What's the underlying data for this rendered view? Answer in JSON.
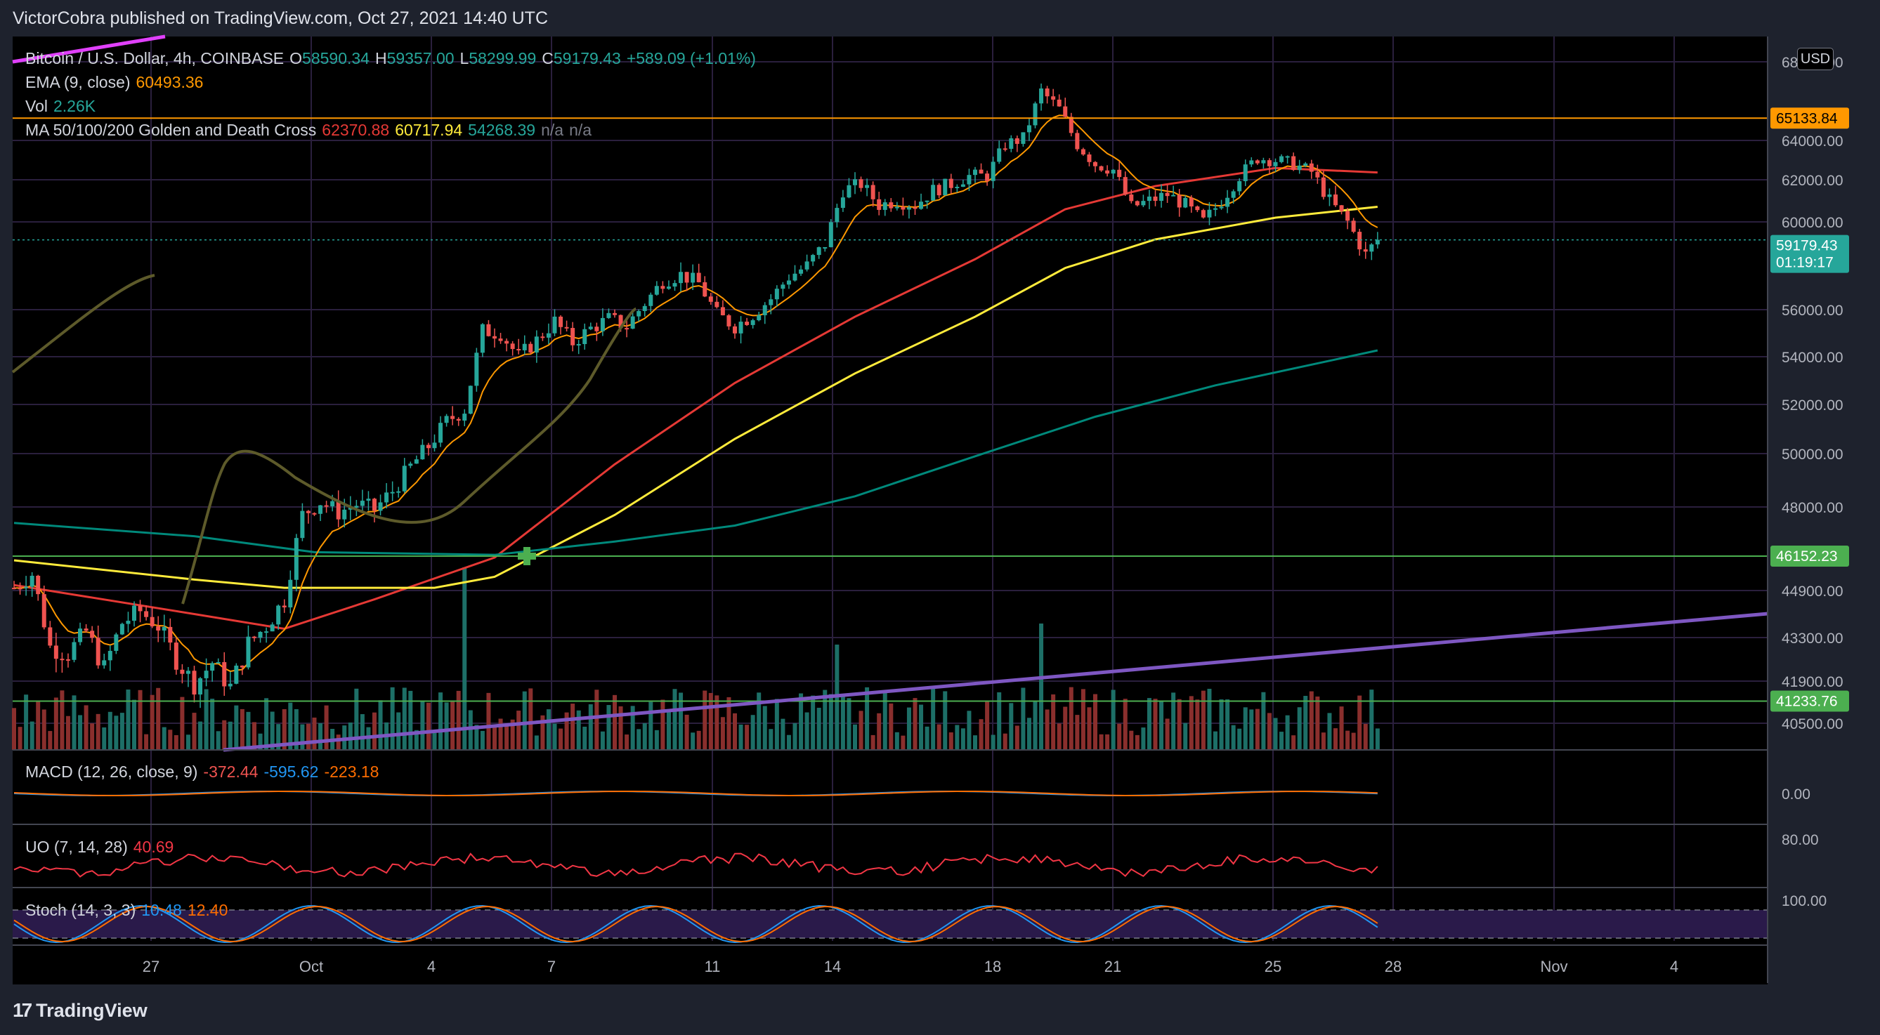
{
  "header": {
    "published": "VictorCobra published on TradingView.com, Oct 27, 2021 14:40 UTC"
  },
  "legend": {
    "symbol": "Bitcoin / U.S. Dollar, 4h, COINBASE",
    "open_label": "O",
    "open": "58590.34",
    "high_label": "H",
    "high": "59357.00",
    "low_label": "L",
    "low": "58299.99",
    "close_label": "C",
    "close": "59179.43",
    "change": "+589.09 (+1.01%)",
    "ema_label": "EMA (9, close)",
    "ema_value": "60493.36",
    "vol_label": "Vol",
    "vol_value": "2.26K",
    "ma_label": "MA 50/100/200 Golden and Death Cross",
    "ma50": "62370.88",
    "ma100": "60717.94",
    "ma200": "54268.39",
    "na1": "n/a",
    "na2": "n/a",
    "macd_label": "MACD (12, 26, close, 9)",
    "macd1": "-372.44",
    "macd2": "-595.62",
    "macd3": "-223.18",
    "uo_label": "UO (7, 14, 28)",
    "uo_value": "40.69",
    "stoch_label": "Stoch (14, 3, 3)",
    "stoch_k": "10.48",
    "stoch_d": "12.40"
  },
  "currency_badge": "USD",
  "footer": {
    "brand": "TradingView"
  },
  "colors": {
    "bull": "#26a69a",
    "bear": "#ef5350",
    "ema": "#ff9800",
    "ma50": "#e53935",
    "ma100": "#ffeb3b",
    "ma200": "#00897b",
    "resistance": "#ff9800",
    "support": "#4caf50",
    "trend": "#7e57c2",
    "pink": "#e040fb",
    "olive": "#5d5a2a"
  },
  "chart_data": {
    "type": "candlestick",
    "title": "Bitcoin / U.S. Dollar, 4h, COINBASE",
    "y_axis_labels": [
      "68000.00",
      "64000.00",
      "62000.00",
      "60000.00",
      "56000.00",
      "54000.00",
      "52000.00",
      "50000.00",
      "48000.00",
      "44900.00",
      "43300.00",
      "41900.00",
      "40500.00"
    ],
    "x_axis_labels": [
      "27",
      "Oct",
      "4",
      "7",
      "11",
      "14",
      "18",
      "21",
      "25",
      "28",
      "Nov",
      "4"
    ],
    "price_badges": [
      {
        "value": "65133.84",
        "color": "#ff9800"
      },
      {
        "value": "59179.43",
        "sub": "01:19:17",
        "color": "#26a69a"
      },
      {
        "value": "46152.23",
        "color": "#4caf50"
      },
      {
        "value": "41233.76",
        "color": "#4caf50"
      }
    ],
    "horizontal_levels": [
      {
        "price": 65133.84,
        "color": "#ff9800"
      },
      {
        "price": 46152.23,
        "color": "#4caf50"
      },
      {
        "price": 41233.76,
        "color": "#4caf50"
      }
    ],
    "trendline": {
      "from": {
        "x": "Sep 29",
        "price": 40100
      },
      "to": {
        "x": "Nov 5",
        "price": 44100
      }
    },
    "golden_cross_marker": {
      "x": "Oct 6",
      "price": 46152.23
    },
    "close_path": [
      {
        "t": 0,
        "p": 45000
      },
      {
        "t": 3,
        "p": 45500
      },
      {
        "t": 6,
        "p": 43000
      },
      {
        "t": 9,
        "p": 42800
      },
      {
        "t": 12,
        "p": 43500
      },
      {
        "t": 15,
        "p": 42300
      },
      {
        "t": 18,
        "p": 43800
      },
      {
        "t": 21,
        "p": 44200
      },
      {
        "t": 24,
        "p": 43700
      },
      {
        "t": 27,
        "p": 42600
      },
      {
        "t": 30,
        "p": 41800
      },
      {
        "t": 33,
        "p": 42500
      },
      {
        "t": 36,
        "p": 41700
      },
      {
        "t": 39,
        "p": 43100
      },
      {
        "t": 42,
        "p": 43700
      },
      {
        "t": 45,
        "p": 44600
      },
      {
        "t": 48,
        "p": 47700
      },
      {
        "t": 51,
        "p": 48200
      },
      {
        "t": 54,
        "p": 47800
      },
      {
        "t": 57,
        "p": 48100
      },
      {
        "t": 60,
        "p": 47900
      },
      {
        "t": 63,
        "p": 48600
      },
      {
        "t": 66,
        "p": 49500
      },
      {
        "t": 69,
        "p": 50300
      },
      {
        "t": 72,
        "p": 51300
      },
      {
        "t": 75,
        "p": 51800
      },
      {
        "t": 78,
        "p": 55100
      },
      {
        "t": 81,
        "p": 55000
      },
      {
        "t": 84,
        "p": 54000
      },
      {
        "t": 87,
        "p": 54700
      },
      {
        "t": 90,
        "p": 55500
      },
      {
        "t": 93,
        "p": 54600
      },
      {
        "t": 96,
        "p": 55200
      },
      {
        "t": 99,
        "p": 55600
      },
      {
        "t": 102,
        "p": 55300
      },
      {
        "t": 105,
        "p": 56300
      },
      {
        "t": 108,
        "p": 57300
      },
      {
        "t": 111,
        "p": 57600
      },
      {
        "t": 114,
        "p": 57200
      },
      {
        "t": 117,
        "p": 55800
      },
      {
        "t": 120,
        "p": 55300
      },
      {
        "t": 123,
        "p": 55800
      },
      {
        "t": 126,
        "p": 56500
      },
      {
        "t": 129,
        "p": 57500
      },
      {
        "t": 132,
        "p": 58000
      },
      {
        "t": 135,
        "p": 59000
      },
      {
        "t": 138,
        "p": 61500
      },
      {
        "t": 141,
        "p": 61800
      },
      {
        "t": 144,
        "p": 60800
      },
      {
        "t": 147,
        "p": 61000
      },
      {
        "t": 150,
        "p": 60800
      },
      {
        "t": 153,
        "p": 61500
      },
      {
        "t": 156,
        "p": 61800
      },
      {
        "t": 159,
        "p": 62200
      },
      {
        "t": 162,
        "p": 62200
      },
      {
        "t": 165,
        "p": 63800
      },
      {
        "t": 168,
        "p": 64100
      },
      {
        "t": 171,
        "p": 66500
      },
      {
        "t": 174,
        "p": 65600
      },
      {
        "t": 177,
        "p": 63800
      },
      {
        "t": 180,
        "p": 62800
      },
      {
        "t": 183,
        "p": 62500
      },
      {
        "t": 186,
        "p": 60700
      },
      {
        "t": 189,
        "p": 61000
      },
      {
        "t": 192,
        "p": 61300
      },
      {
        "t": 195,
        "p": 60800
      },
      {
        "t": 198,
        "p": 60000
      },
      {
        "t": 201,
        "p": 61000
      },
      {
        "t": 204,
        "p": 62200
      },
      {
        "t": 207,
        "p": 63100
      },
      {
        "t": 210,
        "p": 63000
      },
      {
        "t": 213,
        "p": 62800
      },
      {
        "t": 216,
        "p": 62400
      },
      {
        "t": 219,
        "p": 61000
      },
      {
        "t": 222,
        "p": 60000
      },
      {
        "t": 225,
        "p": 58500
      },
      {
        "t": 227,
        "p": 59179
      }
    ],
    "ma_lines": [
      {
        "name": "MA50",
        "color": "#e53935",
        "points": [
          [
            0,
            45100
          ],
          [
            30,
            44100
          ],
          [
            45,
            43600
          ],
          [
            60,
            44600
          ],
          [
            80,
            46100
          ],
          [
            100,
            49600
          ],
          [
            120,
            52900
          ],
          [
            140,
            55700
          ],
          [
            160,
            58300
          ],
          [
            175,
            60600
          ],
          [
            190,
            61700
          ],
          [
            210,
            62600
          ],
          [
            227,
            62370
          ]
        ]
      },
      {
        "name": "MA100",
        "color": "#ffeb3b",
        "points": [
          [
            0,
            46000
          ],
          [
            30,
            45300
          ],
          [
            45,
            45000
          ],
          [
            70,
            45000
          ],
          [
            80,
            45400
          ],
          [
            100,
            47700
          ],
          [
            120,
            50600
          ],
          [
            140,
            53300
          ],
          [
            160,
            55700
          ],
          [
            175,
            57900
          ],
          [
            190,
            59200
          ],
          [
            210,
            60200
          ],
          [
            227,
            60718
          ]
        ]
      },
      {
        "name": "MA200",
        "color": "#00897b",
        "points": [
          [
            0,
            47400
          ],
          [
            30,
            46900
          ],
          [
            50,
            46300
          ],
          [
            80,
            46200
          ],
          [
            100,
            46700
          ],
          [
            120,
            47300
          ],
          [
            140,
            48400
          ],
          [
            160,
            49900
          ],
          [
            180,
            51500
          ],
          [
            200,
            52800
          ],
          [
            227,
            54268
          ]
        ]
      }
    ],
    "oscillators": {
      "macd_zero_label": "0.00",
      "uo_level_label": "80.00",
      "stoch_level_label": "100.00"
    }
  }
}
